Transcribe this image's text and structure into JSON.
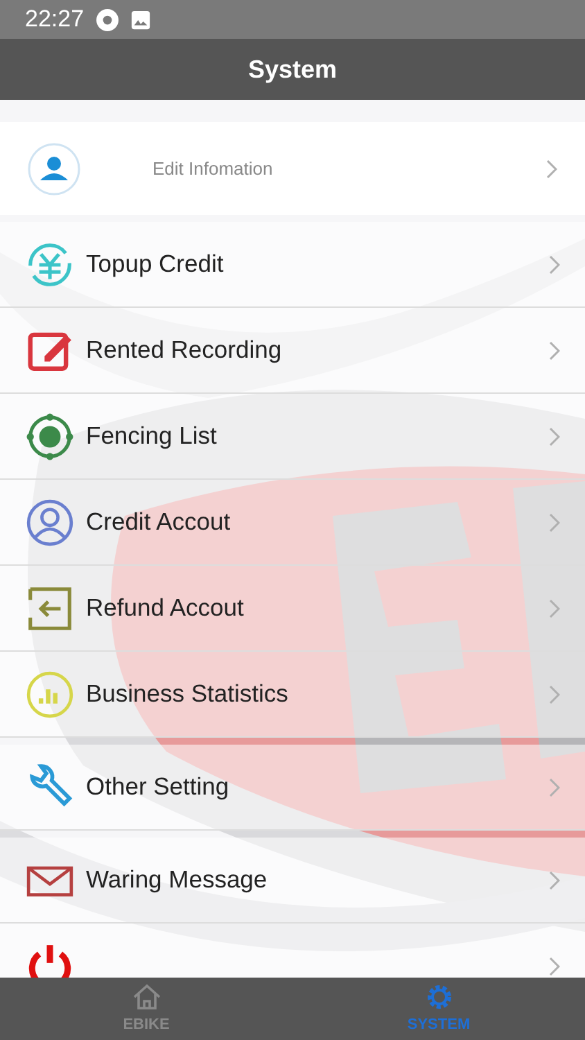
{
  "status_bar": {
    "time": "22:27"
  },
  "header": {
    "title": "System"
  },
  "profile": {
    "label": "Edit Infomation"
  },
  "groups": [
    [
      {
        "kind": "full",
        "label": "Topup Credit"
      },
      {
        "kind": "full",
        "label": "Rented Recording"
      },
      {
        "kind": "full",
        "label": "Fencing List"
      },
      {
        "kind": "full",
        "label": "Credit Accout"
      },
      {
        "kind": "full",
        "label": "Refund Accout"
      },
      {
        "kind": "full",
        "label": "Business Statistics"
      }
    ],
    [
      {
        "kind": "full",
        "label": "Other Setting"
      }
    ],
    [
      {
        "kind": "full",
        "label": "Waring Message"
      },
      {
        "kind": "cut"
      }
    ]
  ],
  "tabs": [
    {
      "label": "EBIKE",
      "selected": false
    },
    {
      "label": "SYSTEM",
      "selected": true
    }
  ]
}
